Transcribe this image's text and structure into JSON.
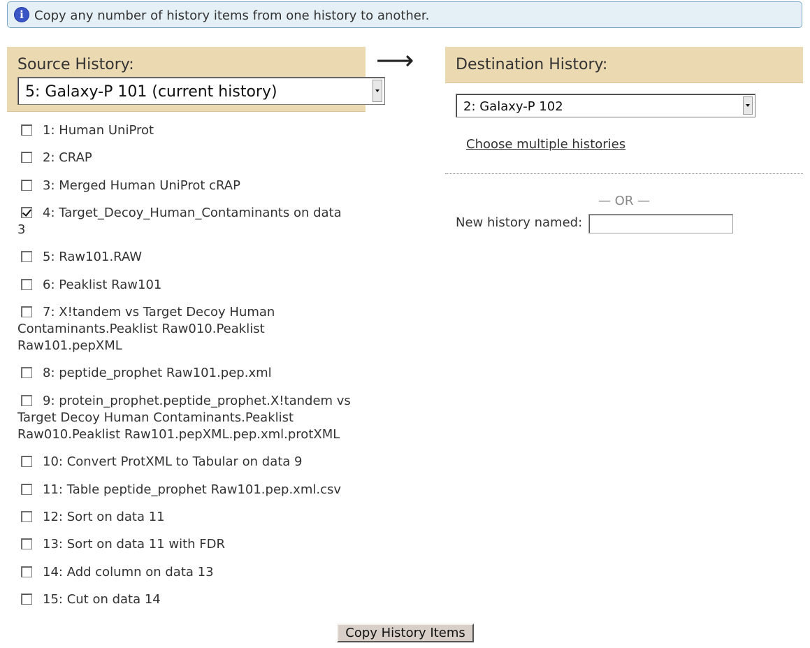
{
  "info": {
    "text": "Copy any number of history items from one history to another."
  },
  "source": {
    "title": "Source History:",
    "selected": "5: Galaxy-P 101 (current history)",
    "items": [
      {
        "label": "1: Human UniProt",
        "checked": false
      },
      {
        "label": "2: CRAP",
        "checked": false
      },
      {
        "label": "3: Merged Human UniProt cRAP",
        "checked": false
      },
      {
        "label": "4: Target_Decoy_Human_Contaminants on data 3",
        "checked": true
      },
      {
        "label": "5: Raw101.RAW",
        "checked": false
      },
      {
        "label": "6: Peaklist Raw101",
        "checked": false
      },
      {
        "label": "7: X!tandem vs Target Decoy Human Contaminants.Peaklist Raw010.Peaklist Raw101.pepXML",
        "checked": false
      },
      {
        "label": "8: peptide_prophet Raw101.pep.xml",
        "checked": false
      },
      {
        "label": "9: protein_prophet.peptide_prophet.X!tandem vs Target Decoy Human Contaminants.Peaklist Raw010.Peaklist Raw101.pepXML.pep.xml.protXML",
        "checked": false
      },
      {
        "label": "10: Convert ProtXML to Tabular on data 9",
        "checked": false
      },
      {
        "label": "11: Table peptide_prophet Raw101.pep.xml.csv",
        "checked": false
      },
      {
        "label": "12: Sort on data 11",
        "checked": false
      },
      {
        "label": "13: Sort on data 11 with FDR",
        "checked": false
      },
      {
        "label": "14: Add column on data 13",
        "checked": false
      },
      {
        "label": "15: Cut on data 14",
        "checked": false
      }
    ]
  },
  "arrow": "⟶",
  "destination": {
    "title": "Destination History:",
    "selected": "2: Galaxy-P 102",
    "choose_multiple": "Choose multiple histories",
    "or_text": "— OR —",
    "new_history_label": "New history named:",
    "new_history_value": ""
  },
  "submit_label": "Copy History Items",
  "colors": {
    "header_bg": "#ebd9b2",
    "info_bg": "#e4f0f6",
    "info_icon": "#3a55c6"
  }
}
